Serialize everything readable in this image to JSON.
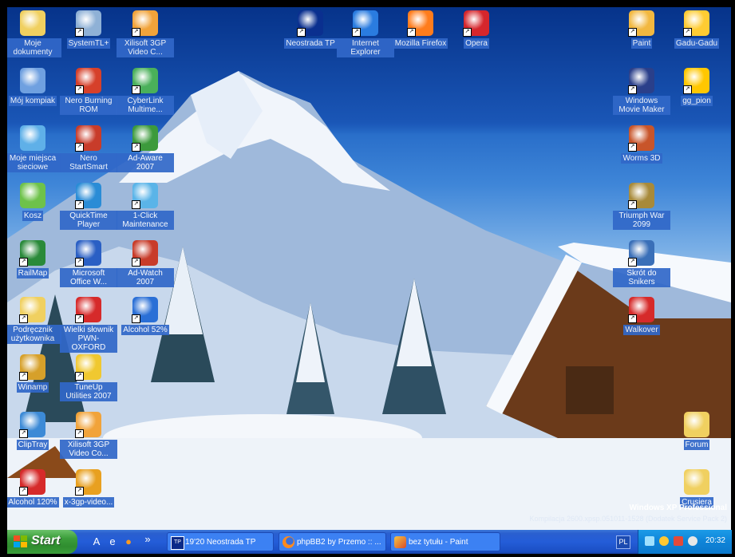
{
  "desktop_icons": [
    {
      "label": "Moje dokumenty",
      "icon": "folder-documents-icon"
    },
    {
      "label": "SystemTL+",
      "icon": "tools-icon"
    },
    {
      "label": "Xilisoft 3GP Video C...",
      "icon": "video-converter-icon"
    },
    {
      "label": "Neostrada TP",
      "icon": "tp-logo-icon"
    },
    {
      "label": "Internet Explorer",
      "icon": "ie-icon"
    },
    {
      "label": "Mozilla Firefox",
      "icon": "firefox-icon"
    },
    {
      "label": "Opera",
      "icon": "opera-icon"
    },
    {
      "label": "Paint",
      "icon": "paint-icon"
    },
    {
      "label": "Gadu-Gadu",
      "icon": "gadu-gadu-icon"
    },
    {
      "label": "Mój kompiak",
      "icon": "my-computer-icon"
    },
    {
      "label": "Nero Burning ROM",
      "icon": "nero-icon"
    },
    {
      "label": "CyberLink Multime...",
      "icon": "cyberlink-icon"
    },
    {
      "label": "Windows Movie Maker",
      "icon": "movie-maker-icon"
    },
    {
      "label": "gg_pion",
      "icon": "sun-icon"
    },
    {
      "label": "Moje miejsca sieciowe",
      "icon": "network-places-icon"
    },
    {
      "label": "Nero StartSmart",
      "icon": "nero-startsmart-icon"
    },
    {
      "label": "Ad-Aware 2007",
      "icon": "ad-aware-icon"
    },
    {
      "label": "Worms 3D",
      "icon": "worms-icon"
    },
    {
      "label": "Kosz",
      "icon": "recycle-bin-icon"
    },
    {
      "label": "QuickTime Player",
      "icon": "quicktime-icon"
    },
    {
      "label": "1-Click Maintenance",
      "icon": "maintenance-icon"
    },
    {
      "label": "Triumph War 2099",
      "icon": "game-icon"
    },
    {
      "label": "RailMap",
      "icon": "railmap-icon"
    },
    {
      "label": "Microsoft Office W...",
      "icon": "word-icon"
    },
    {
      "label": "Ad-Watch 2007",
      "icon": "ad-watch-icon"
    },
    {
      "label": "Skrót do Snikers",
      "icon": "shortcut-icon"
    },
    {
      "label": "Podręcznik użytkownika",
      "icon": "manual-icon"
    },
    {
      "label": "Wielki słownik PWN-OXFORD",
      "icon": "dictionary-icon"
    },
    {
      "label": "Alcohol 52%",
      "icon": "alcohol-icon"
    },
    {
      "label": "Walkover",
      "icon": "walkover-icon"
    },
    {
      "label": "Winamp",
      "icon": "winamp-icon"
    },
    {
      "label": "TuneUp Utilities 2007",
      "icon": "tuneup-icon"
    },
    {
      "label": "ClipTray",
      "icon": "cliptray-icon"
    },
    {
      "label": "Xilisoft 3GP Video Co...",
      "icon": "video-converter-icon"
    },
    {
      "label": "Forum",
      "icon": "folder-icon"
    },
    {
      "label": "Alcohol 120%",
      "icon": "alcohol-icon"
    },
    {
      "label": "x-3gp-video...",
      "icon": "gear-icon"
    },
    {
      "label": "Crusiera",
      "icon": "folder-icon"
    }
  ],
  "watermark": {
    "line1": "Windows XP Professional",
    "line2": "Kompilacja 2600.xpsp.051011-1528 (Dodatek Service Pack 2)"
  },
  "taskbar": {
    "start_label": "Start",
    "quick_launch_more": "»",
    "tasks": [
      {
        "label": "19'20 Neostrada TP",
        "icon": "tp-logo-icon"
      },
      {
        "label": "phpBB2 by Przemo :: ...",
        "icon": "firefox-icon"
      },
      {
        "label": "bez tytułu - Paint",
        "icon": "paint-icon"
      }
    ],
    "language": "PL",
    "clock": "20:32"
  },
  "colors": {
    "taskbar": "#245dd8",
    "start_button": "#3c9e3b",
    "label_highlight": "#3168c9",
    "tray": "#0f84d8"
  }
}
